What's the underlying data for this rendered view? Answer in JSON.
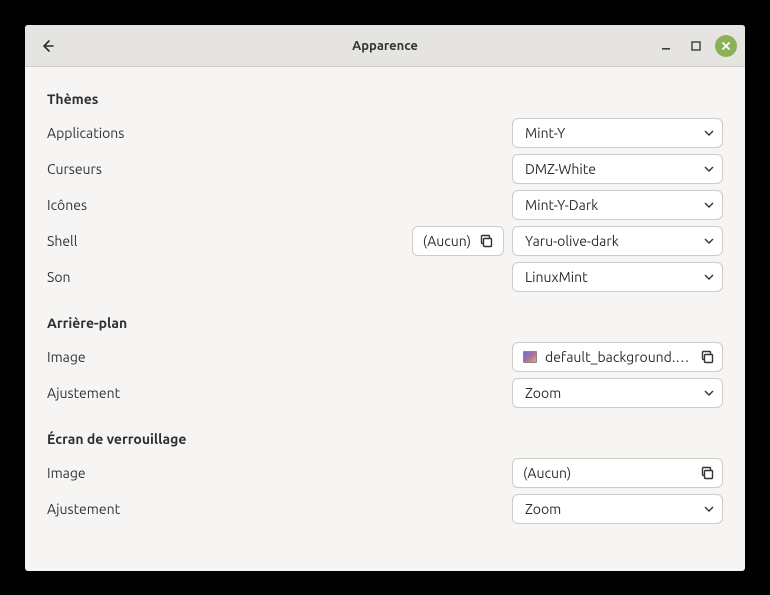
{
  "window": {
    "title": "Apparence"
  },
  "sections": {
    "themes": {
      "title": "Thèmes",
      "applications": {
        "label": "Applications",
        "value": "Mint-Y"
      },
      "cursors": {
        "label": "Curseurs",
        "value": "DMZ-White"
      },
      "icons": {
        "label": "Icônes",
        "value": "Mint-Y-Dark"
      },
      "shell": {
        "label": "Shell",
        "extra": "(Aucun)",
        "value": "Yaru-olive-dark"
      },
      "sound": {
        "label": "Son",
        "value": "LinuxMint"
      }
    },
    "background": {
      "title": "Arrière-plan",
      "image": {
        "label": "Image",
        "value": "default_background.jpg"
      },
      "adjust": {
        "label": "Ajustement",
        "value": "Zoom"
      }
    },
    "lockscreen": {
      "title": "Écran de verrouillage",
      "image": {
        "label": "Image",
        "value": "(Aucun)"
      },
      "adjust": {
        "label": "Ajustement",
        "value": "Zoom"
      }
    }
  }
}
